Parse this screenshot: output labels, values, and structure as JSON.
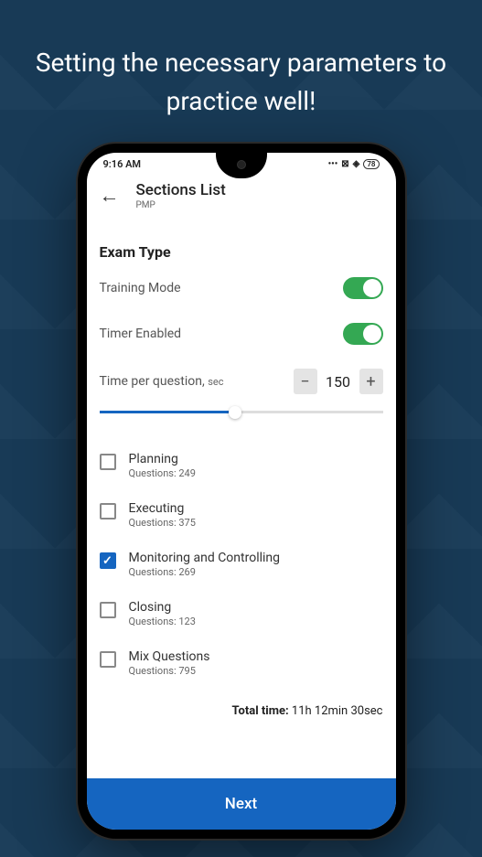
{
  "heading": "Setting the necessary parameters to practice well!",
  "status": {
    "time": "9:16 AM",
    "battery": "78"
  },
  "header": {
    "title": "Sections List",
    "subtitle": "PMP"
  },
  "exam": {
    "section_title": "Exam Type",
    "training_label": "Training Mode",
    "timer_label": "Timer Enabled",
    "time_per_q_label": "Time per question,",
    "time_per_q_unit": "sec",
    "time_value": "150"
  },
  "sections": [
    {
      "name": "Planning",
      "count": "Questions: 249",
      "checked": false
    },
    {
      "name": "Executing",
      "count": "Questions: 375",
      "checked": false
    },
    {
      "name": "Monitoring and Controlling",
      "count": "Questions: 269",
      "checked": true
    },
    {
      "name": "Closing",
      "count": "Questions: 123",
      "checked": false
    },
    {
      "name": "Mix Questions",
      "count": "Questions: 795",
      "checked": false
    }
  ],
  "total": {
    "label": "Total time:",
    "value": "11h 12min 30sec"
  },
  "next_label": "Next"
}
